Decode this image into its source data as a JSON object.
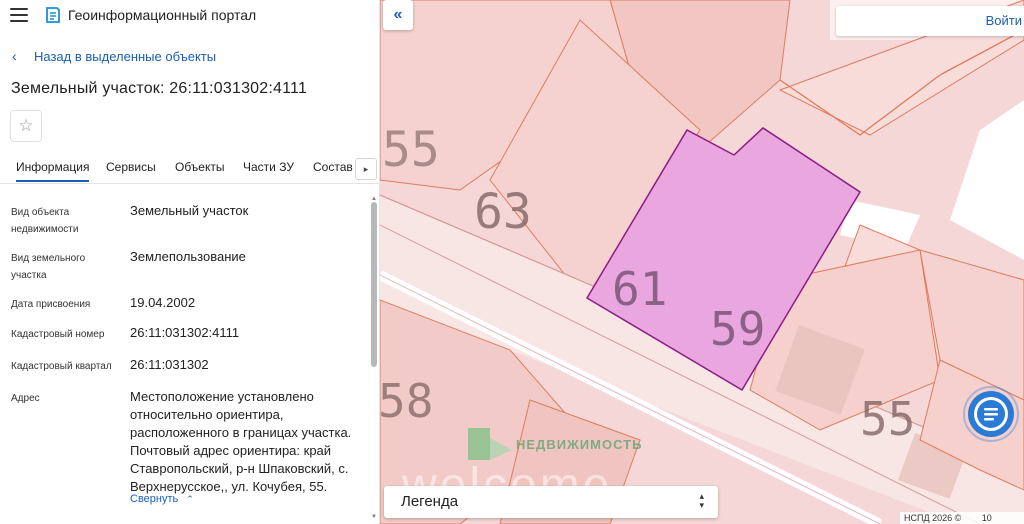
{
  "app": {
    "title": "Геоинформационный портал"
  },
  "nav": {
    "back_label": "Назад в выделенные объекты"
  },
  "object": {
    "title": "Земельный участок: 26:11:031302:4111"
  },
  "tabs": [
    {
      "label": "Информация",
      "active": true
    },
    {
      "label": "Сервисы"
    },
    {
      "label": "Объекты"
    },
    {
      "label": "Части ЗУ"
    },
    {
      "label": "Состав"
    }
  ],
  "properties": [
    {
      "label": "Вид объекта недвижимости",
      "value": "Земельный участок"
    },
    {
      "label": "Вид земельного участка",
      "value": "Землепользование"
    },
    {
      "label": "Дата присвоения",
      "value": "19.04.2002"
    },
    {
      "label": "Кадастровый номер",
      "value": "26:11:031302:4111"
    },
    {
      "label": "Кадастровый квартал",
      "value": "26:11:031302"
    },
    {
      "label": "Адрес",
      "value": "Местоположение установлено относительно ориентира, расположенного в границах участка. Почтовый адрес ориентира: край Ставропольский, р-н Шпаковский, с. Верхнерусское,, ул. Кочубея, 55."
    }
  ],
  "collapse_label": "Свернуть",
  "map": {
    "login_label": "Войти",
    "legend_label": "Легенда",
    "watermark_text": "НЕДВИЖИМОСТЬ",
    "watermark_big": "welcome",
    "copyright": "НСПД 2026 ©",
    "scale_fragment": "10",
    "parcel_numbers": [
      "55",
      "63",
      "61",
      "59",
      "58",
      "55"
    ],
    "colors": {
      "parcel_fill": "#f4d7d6",
      "selected_fill": "#e9a6df",
      "selected_border": "#8c1c86",
      "boundary": "#e07b5c",
      "accent": "#1a5fb4"
    }
  }
}
